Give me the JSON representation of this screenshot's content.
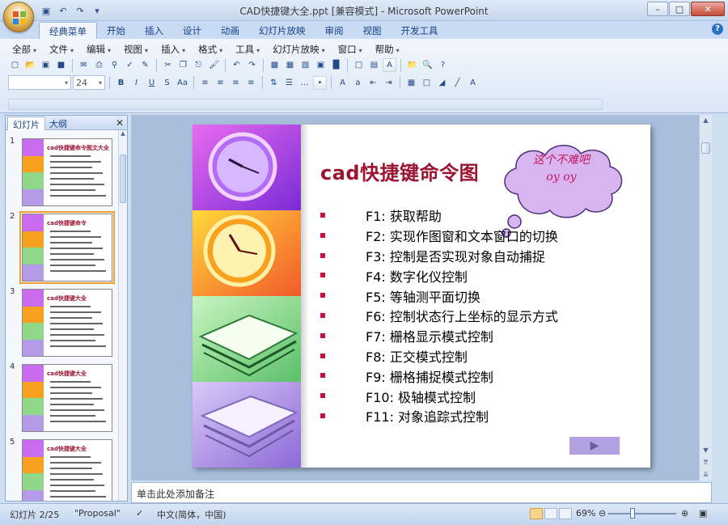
{
  "window": {
    "title": "CAD快捷键大全.ppt [兼容模式] - Microsoft PowerPoint"
  },
  "ribbon_tabs": [
    "经典菜单",
    "开始",
    "插入",
    "设计",
    "动画",
    "幻灯片放映",
    "审阅",
    "视图",
    "开发工具"
  ],
  "classic_menus": [
    "全部",
    "文件",
    "编辑",
    "视图",
    "插入",
    "格式",
    "工具",
    "幻灯片放映",
    "窗口",
    "帮助"
  ],
  "font_size_value": "24",
  "pane_tabs": {
    "slides": "幻灯片",
    "outline": "大纲"
  },
  "thumbnails": [
    {
      "num": "1",
      "title": "cad快捷键命令图文大全",
      "selected": false
    },
    {
      "num": "2",
      "title": "cad快捷键命令",
      "selected": true
    },
    {
      "num": "3",
      "title": "cad快捷键大全",
      "selected": false
    },
    {
      "num": "4",
      "title": "cad快捷键大全",
      "selected": false
    },
    {
      "num": "5",
      "title": "cad快捷键大全",
      "selected": false
    }
  ],
  "slide": {
    "title": "cad快捷键命令图",
    "cloud_text_line1": "这个不难吧",
    "cloud_text_line2": "oy oy",
    "bullets": [
      "F1: 获取帮助",
      "F2: 实现作图窗和文本窗口的切换",
      "F3: 控制是否实现对象自动捕捉",
      "F4: 数字化仪控制",
      "F5: 等轴测平面切换",
      "F6: 控制状态行上坐标的显示方式",
      "F7: 栅格显示模式控制",
      "F8: 正交模式控制",
      "F9: 栅格捕捉模式控制",
      "F10: 极轴模式控制",
      "F11: 对象追踪式控制"
    ]
  },
  "notes_placeholder": "单击此处添加备注",
  "status": {
    "slide_counter": "幻灯片 2/25",
    "theme": "\"Proposal\"",
    "language": "中文(简体，中国)",
    "zoom": "69%"
  },
  "colors": {
    "title_red": "#9b1432",
    "bullet_red": "#c4123c",
    "cloud_fill": "#d8b4f0",
    "ribbon_blue": "#15428b"
  }
}
